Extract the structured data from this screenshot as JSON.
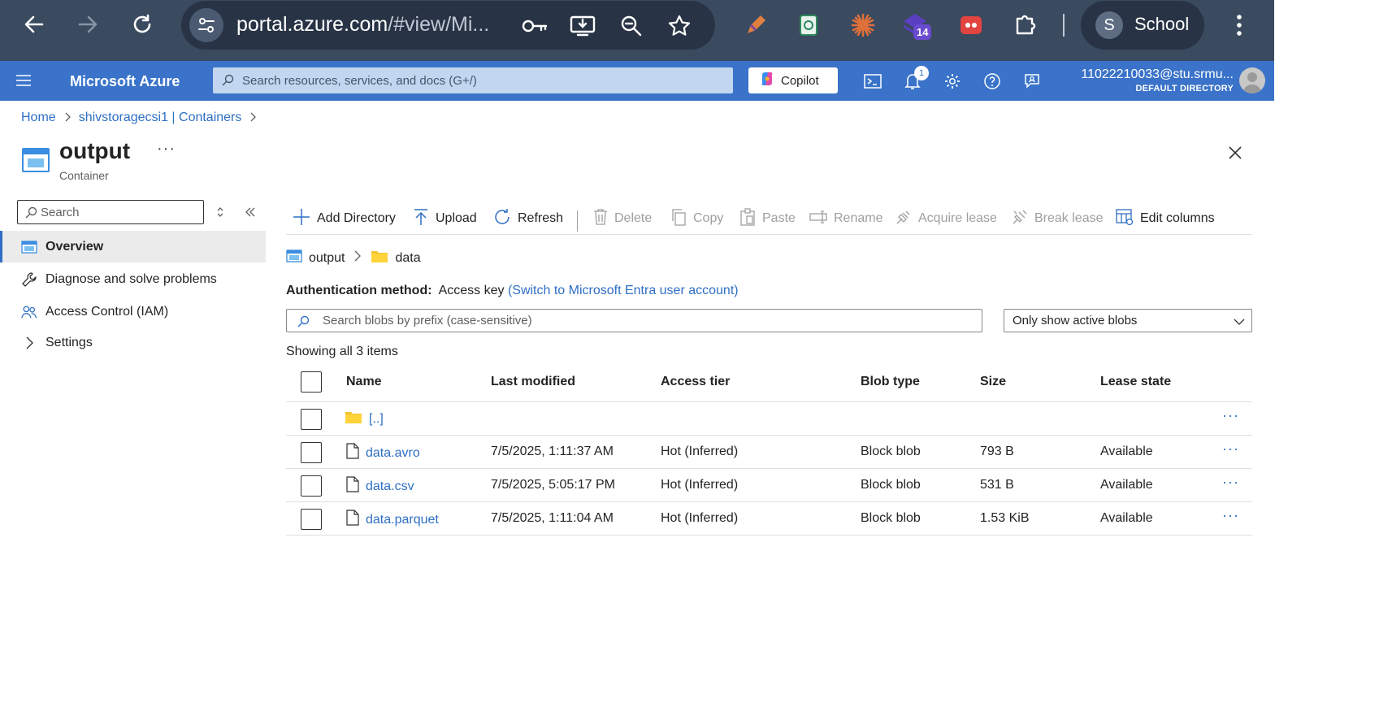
{
  "browser": {
    "url_main": "portal.azure.com",
    "url_rest": "/#view/Mi...",
    "extension_badge": "14",
    "profile_initial": "S",
    "profile_name": "School"
  },
  "azure_bar": {
    "brand": "Microsoft Azure",
    "search_placeholder": "Search resources, services, and docs (G+/)",
    "copilot_label": "Copilot",
    "notification_count": "1",
    "account_email": "11022210033@stu.srmu...",
    "account_directory": "DEFAULT DIRECTORY"
  },
  "breadcrumb": {
    "items": [
      "Home",
      "shivstoragecsi1 | Containers"
    ]
  },
  "page": {
    "title": "output",
    "more": "···",
    "subtitle": "Container"
  },
  "nav": {
    "search_placeholder": "Search",
    "items": [
      {
        "label": "Overview",
        "icon": "container-icon"
      },
      {
        "label": "Diagnose and solve problems",
        "icon": "wrench-icon"
      },
      {
        "label": "Access Control (IAM)",
        "icon": "people-icon"
      },
      {
        "label": "Settings",
        "icon": "chevron-right-icon"
      }
    ]
  },
  "toolbar": {
    "add_directory": "Add Directory",
    "upload": "Upload",
    "refresh": "Refresh",
    "delete": "Delete",
    "copy": "Copy",
    "paste": "Paste",
    "rename": "Rename",
    "acquire_lease": "Acquire lease",
    "break_lease": "Break lease",
    "edit_columns": "Edit columns"
  },
  "path": {
    "container": "output",
    "folder": "data"
  },
  "auth": {
    "label": "Authentication method:",
    "value": "Access key",
    "switch_link": "(Switch to Microsoft Entra user account)"
  },
  "blob_search": {
    "placeholder": "Search blobs by prefix (case-sensitive)"
  },
  "filter": {
    "selected": "Only show active blobs"
  },
  "showing": "Showing all 3 items",
  "table": {
    "headers": [
      "Name",
      "Last modified",
      "Access tier",
      "Blob type",
      "Size",
      "Lease state"
    ],
    "parent_folder": "[..]",
    "rows": [
      {
        "name": "data.avro",
        "modified": "7/5/2025, 1:11:37 AM",
        "tier": "Hot (Inferred)",
        "type": "Block blob",
        "size": "793 B",
        "lease": "Available"
      },
      {
        "name": "data.csv",
        "modified": "7/5/2025, 5:05:17 PM",
        "tier": "Hot (Inferred)",
        "type": "Block blob",
        "size": "531 B",
        "lease": "Available"
      },
      {
        "name": "data.parquet",
        "modified": "7/5/2025, 1:11:04 AM",
        "tier": "Hot (Inferred)",
        "type": "Block blob",
        "size": "1.53 KiB",
        "lease": "Available"
      }
    ],
    "row_more": "···"
  },
  "colors": {
    "chrome": "#3a4a5f",
    "azure_bar": "#3a73c9",
    "link": "#2f6fc4"
  }
}
